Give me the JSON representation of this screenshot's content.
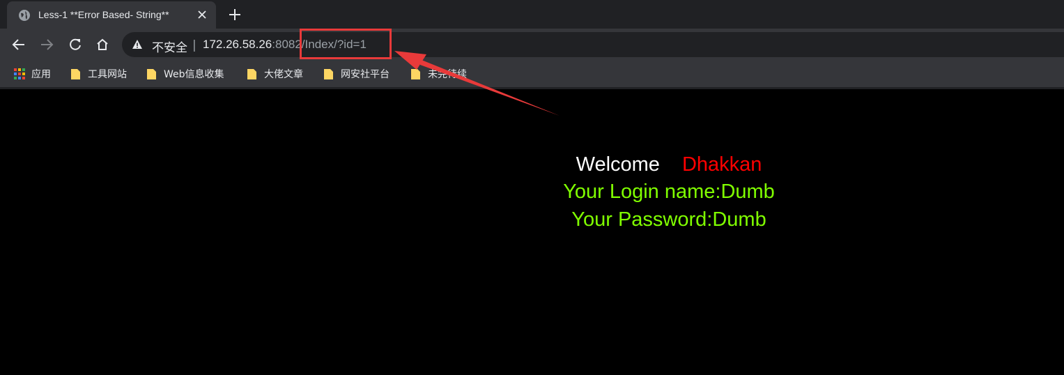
{
  "tab": {
    "title": "Less-1 **Error Based- String**"
  },
  "toolbar": {
    "security_label": "不安全",
    "separator": "|",
    "url_host": "172.26.58.26",
    "url_rest": ":8082/Index/?id=1"
  },
  "bookmarks": [
    {
      "label": "应用",
      "icon": "apps-grid-icon"
    },
    {
      "label": "工具网站",
      "icon": "folder-icon"
    },
    {
      "label": "Web信息收集",
      "icon": "folder-icon"
    },
    {
      "label": "大佬文章",
      "icon": "folder-icon"
    },
    {
      "label": "网安社平台",
      "icon": "folder-icon"
    },
    {
      "label": "未完待续",
      "icon": "folder-icon"
    }
  ],
  "content": {
    "welcome": "Welcome",
    "name": "Dhakkan",
    "login_line": "Your Login name:Dumb",
    "password_line": "Your Password:Dumb"
  },
  "colors": {
    "page_bg": "#000000",
    "welcome": "#ffffff",
    "name": "#ff0000",
    "result": "#80ff00",
    "annotation": "#e83a3a"
  }
}
